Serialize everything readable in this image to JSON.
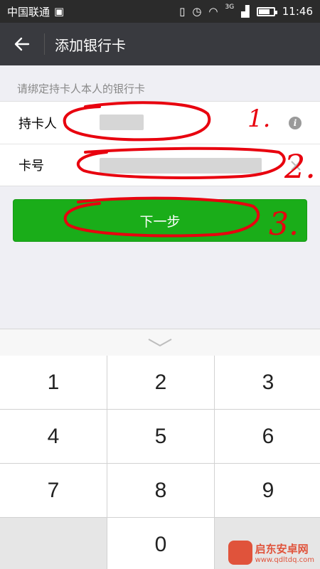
{
  "status_bar": {
    "carrier": "中国联通",
    "carrier_icon": "image-icon",
    "network_label": "3G",
    "time": "11:46",
    "battery_level": 0.8
  },
  "header": {
    "title": "添加银行卡",
    "back_icon": "arrow-left-icon"
  },
  "form": {
    "hint": "请绑定持卡人本人的银行卡",
    "holder_label": "持卡人",
    "card_label": "卡号"
  },
  "next_button": {
    "label": "下一步"
  },
  "annotations": {
    "one": "1.",
    "two": "2.",
    "three": "3."
  },
  "keypad": {
    "keys": [
      "1",
      "2",
      "3",
      "4",
      "5",
      "6",
      "7",
      "8",
      "9",
      "",
      "0",
      ""
    ]
  },
  "watermark": {
    "name": "启东安卓网",
    "url": "www.qdltdq.com"
  },
  "colors": {
    "status_bg": "#2b2b2b",
    "header_bg": "#393a3f",
    "primary_green": "#1aad19",
    "annotation_red": "#e8000e"
  }
}
